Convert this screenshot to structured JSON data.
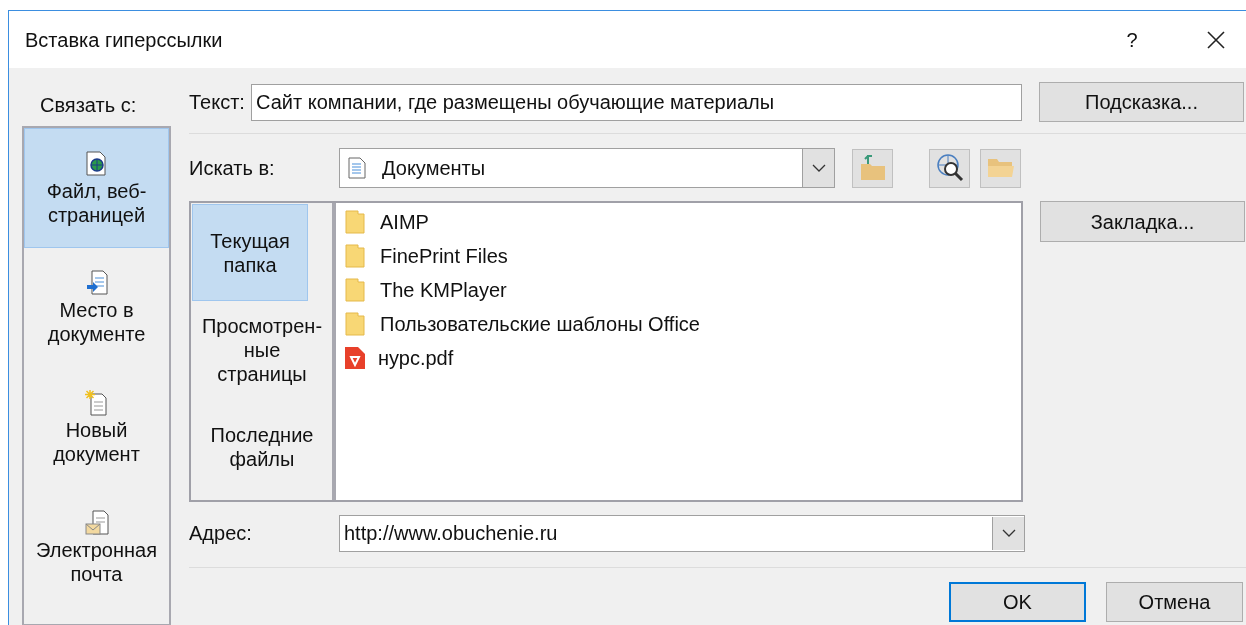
{
  "window": {
    "title": "Вставка гиперссылки",
    "help": "?"
  },
  "link_to": {
    "label": "Связать с:",
    "items": [
      {
        "kind": "file",
        "lines": [
          "Файл, веб-",
          "страницей"
        ],
        "selected": true
      },
      {
        "kind": "place",
        "lines": [
          "Место в",
          "документе"
        ],
        "selected": false
      },
      {
        "kind": "new",
        "lines": [
          "Новый",
          "документ"
        ],
        "selected": false
      },
      {
        "kind": "email",
        "lines": [
          "Электронная",
          "почта"
        ],
        "selected": false
      }
    ]
  },
  "text_field": {
    "label": "Текст:",
    "value": "Сайт компании, где размещены обучающие материалы"
  },
  "hint_button": "Подсказка...",
  "look_in": {
    "label": "Искать в:",
    "value": "Документы"
  },
  "nav": [
    {
      "lines": [
        "Текущая",
        "папка"
      ],
      "selected": true
    },
    {
      "lines": [
        "Просмотрен-",
        "ные",
        "страницы"
      ],
      "selected": false
    },
    {
      "lines": [
        "Последние",
        "файлы"
      ],
      "selected": false
    }
  ],
  "files": [
    {
      "kind": "folder",
      "name": "AIMP"
    },
    {
      "kind": "folder",
      "name": "FinePrint Files"
    },
    {
      "kind": "folder",
      "name": "The KMPlayer"
    },
    {
      "kind": "folder",
      "name": "Пользовательские шаблоны Office"
    },
    {
      "kind": "pdf",
      "name": "нурс.pdf"
    }
  ],
  "bookmark_button": "Закладка...",
  "address": {
    "label": "Адрес:",
    "value": "http://www.obuchenie.ru"
  },
  "buttons": [
    {
      "label": "OK",
      "default": true
    },
    {
      "label": "Отмена",
      "default": false
    }
  ]
}
